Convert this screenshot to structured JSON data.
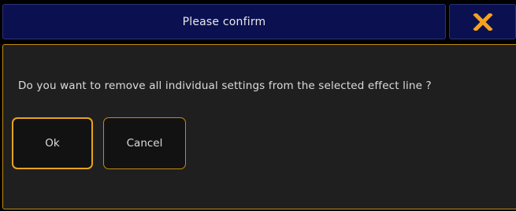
{
  "dialog": {
    "title": "Please confirm",
    "close_icon": "close-x-icon",
    "message": "Do you want to remove all individual settings from the selected effect line ?",
    "buttons": {
      "ok_label": "Ok",
      "cancel_label": "Cancel"
    }
  },
  "colors": {
    "title_bar_bg": "#0b1150",
    "accent": "#e6a41d",
    "panel_bg": "#1f1f1f",
    "text": "#dcdcdc"
  }
}
